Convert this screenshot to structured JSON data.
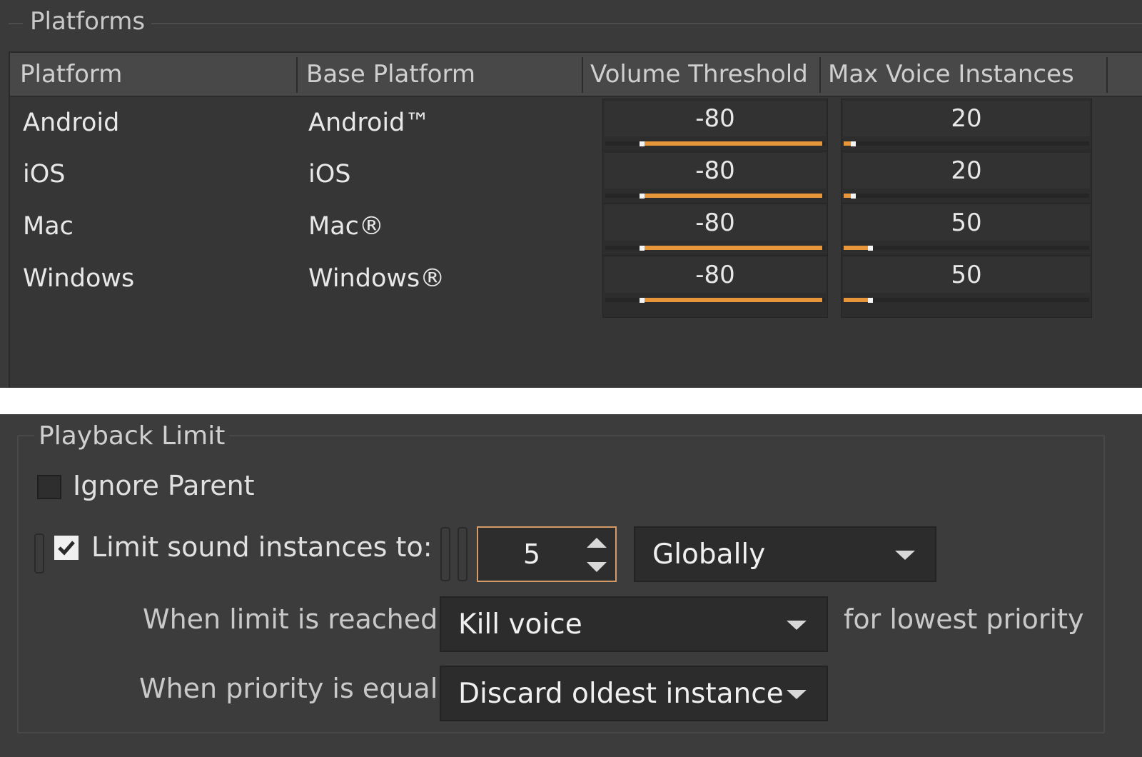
{
  "platforms": {
    "legend": "Platforms",
    "headers": [
      "Platform",
      "Base Platform",
      "Volume Threshold",
      "Max Voice Instances"
    ],
    "rows": [
      {
        "platform": "Android",
        "base": "Android™",
        "volume": "-80",
        "volume_level": 1.0,
        "voices": "20",
        "voices_level": 0.05
      },
      {
        "platform": "iOS",
        "base": "iOS",
        "volume": "-80",
        "volume_level": 1.0,
        "voices": "20",
        "voices_level": 0.05
      },
      {
        "platform": "Mac",
        "base": "Mac®",
        "volume": "-80",
        "volume_level": 1.0,
        "voices": "50",
        "voices_level": 0.12
      },
      {
        "platform": "Windows",
        "base": "Windows®",
        "volume": "-80",
        "volume_level": 1.0,
        "voices": "50",
        "voices_level": 0.12
      }
    ]
  },
  "playback_limit": {
    "legend": "Playback Limit",
    "ignore_parent_label": "Ignore Parent",
    "ignore_parent_checked": false,
    "limit_label": "Limit sound instances to:",
    "limit_checked": true,
    "limit_value": "5",
    "scope_value": "Globally",
    "when_limit_label": "When limit is reached:",
    "when_limit_value": "Kill voice",
    "for_lowest_label": "for lowest priority",
    "when_priority_label": "When priority is equal:",
    "when_priority_value": "Discard oldest instance"
  },
  "colors": {
    "accent": "#e8963a",
    "panel_bg": "#3c3c3c",
    "field_border_focus": "#d49a6a"
  },
  "icons": [
    "check-icon",
    "spin-up-icon",
    "spin-down-icon",
    "dropdown-caret-icon",
    "link-icon"
  ]
}
